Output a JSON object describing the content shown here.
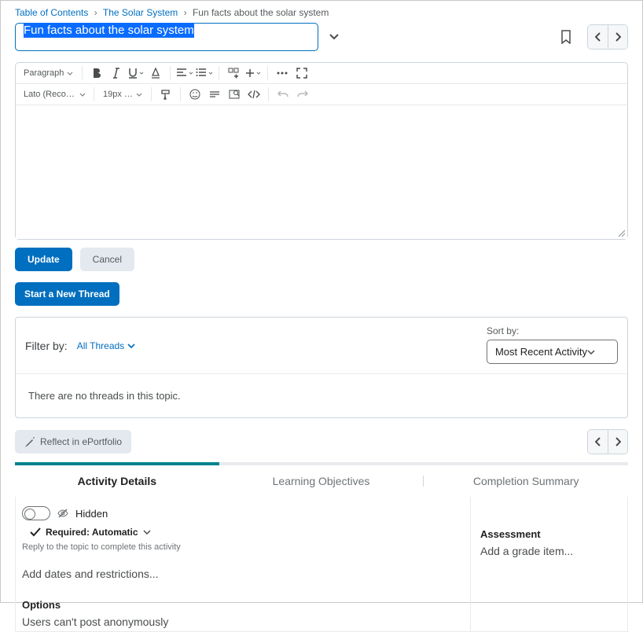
{
  "breadcrumb": {
    "items": [
      "Table of Contents",
      "The Solar System"
    ],
    "current": "Fun facts about the solar system"
  },
  "title_input": "Fun facts about the solar system",
  "editor": {
    "para_label": "Paragraph",
    "font_label": "Lato (Recom…",
    "size_label": "19px …"
  },
  "buttons": {
    "update": "Update",
    "cancel": "Cancel",
    "new_thread": "Start a New Thread",
    "reflect": "Reflect in ePortfolio"
  },
  "filter": {
    "label": "Filter by:",
    "all_threads": "All Threads",
    "sort_label": "Sort by:",
    "sort_value": "Most Recent Activity",
    "empty": "There are no threads in this topic."
  },
  "tabs": {
    "activity": "Activity Details",
    "objectives": "Learning Objectives",
    "completion": "Completion Summary"
  },
  "details": {
    "hidden": "Hidden",
    "required": "Required: Automatic",
    "help": "Reply to the topic to complete this activity",
    "dates": "Add dates and restrictions...",
    "options_h": "Options",
    "options_line": "Users can't post anonymously",
    "assessment_h": "Assessment",
    "assessment_line": "Add a grade item..."
  }
}
